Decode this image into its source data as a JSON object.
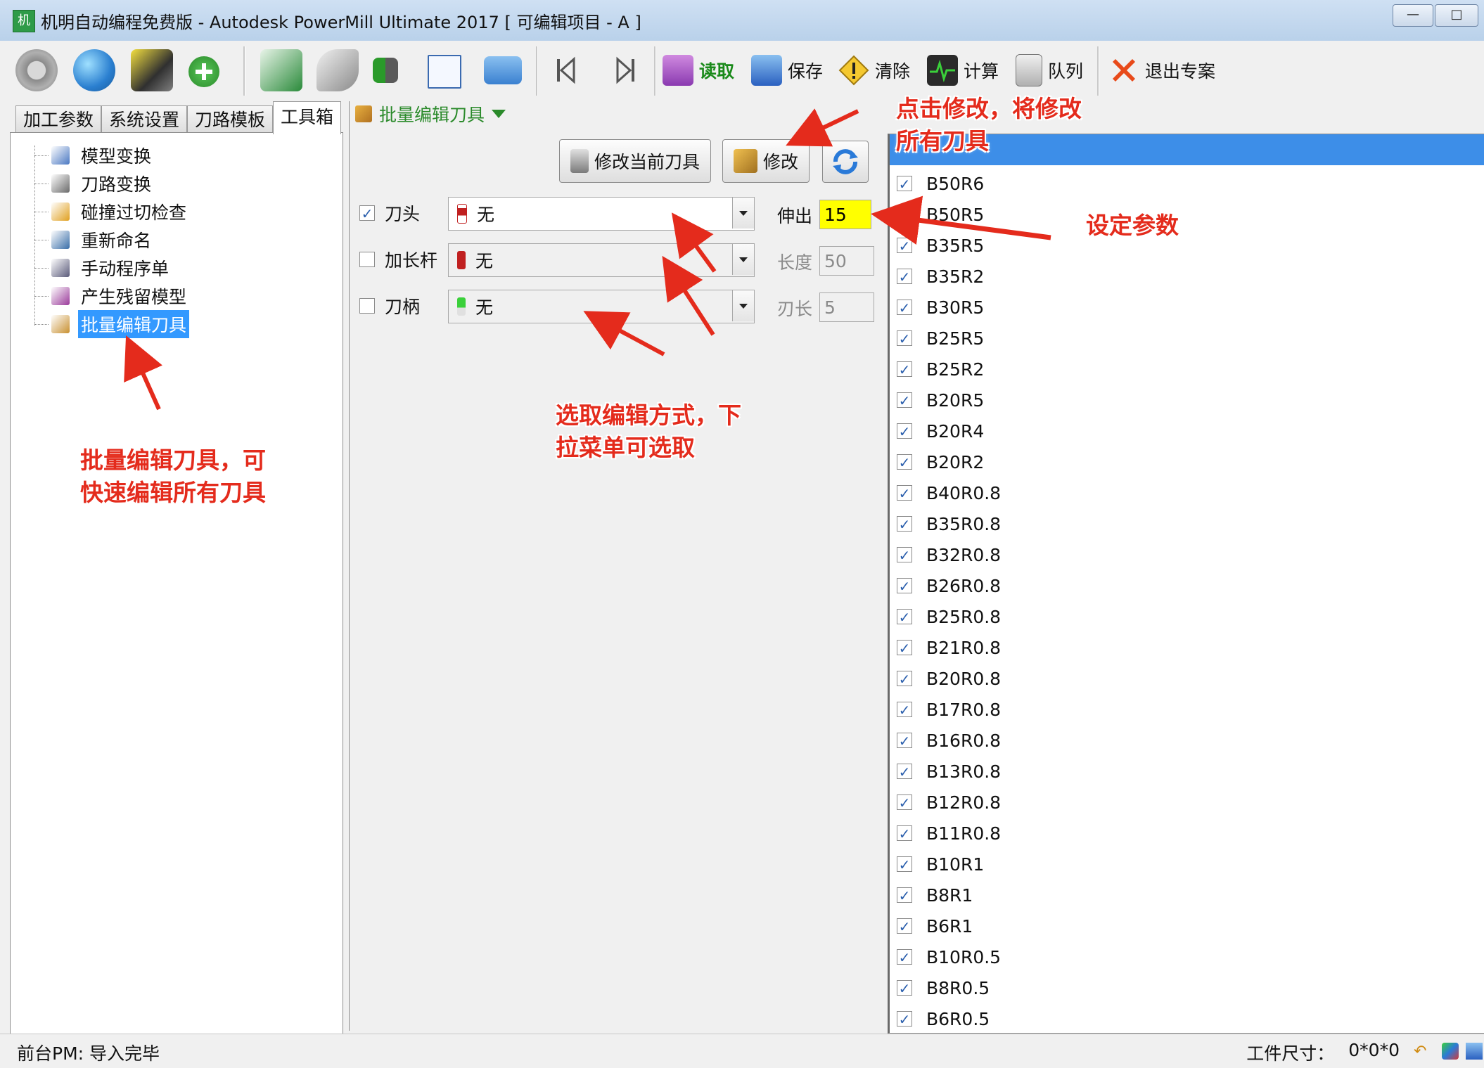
{
  "window": {
    "title": "机明自动编程免费版 - Autodesk PowerMill Ultimate 2017  [ 可编辑项目 - A ]",
    "app_icon_text": "机",
    "minimize": "—",
    "maximize": "□"
  },
  "toolbar": {
    "read_label": "读取",
    "save_label": "保存",
    "clear_label": "清除",
    "compute_label": "计算",
    "queue_label": "队列",
    "exit_label": "退出专案"
  },
  "left_tabs": [
    "加工参数",
    "系统设置",
    "刀路模板",
    "工具箱"
  ],
  "tree": {
    "items": [
      {
        "label": "模型变换",
        "icon": "model-transform-icon",
        "color": "#4a78c2"
      },
      {
        "label": "刀路变换",
        "icon": "toolpath-transform-icon",
        "color": "#6a6a6a"
      },
      {
        "label": "碰撞过切检查",
        "icon": "collision-check-icon",
        "color": "#e0a020"
      },
      {
        "label": "重新命名",
        "icon": "rename-icon",
        "color": "#3a6ea8"
      },
      {
        "label": "手动程序单",
        "icon": "manual-sheet-icon",
        "color": "#5a5a7a"
      },
      {
        "label": "产生残留模型",
        "icon": "stock-model-icon",
        "color": "#9a3a9a"
      },
      {
        "label": "批量编辑刀具",
        "icon": "batch-edit-tools-icon",
        "color": "#c89030"
      }
    ]
  },
  "mid": {
    "header": "批量编辑刀具",
    "modify_current_btn": "修改当前刀具",
    "modify_btn": "修改",
    "rows": [
      {
        "label": "刀头",
        "checked": true,
        "value": "无",
        "param_label": "伸出",
        "param_value": "15",
        "enabled": true
      },
      {
        "label": "加长杆",
        "checked": false,
        "value": "无",
        "param_label": "长度",
        "param_value": "50",
        "enabled": false
      },
      {
        "label": "刀柄",
        "checked": false,
        "value": "无",
        "param_label": "刃长",
        "param_value": "5",
        "enabled": false
      }
    ]
  },
  "tool_list": [
    "B50R6",
    "B50R5",
    "B35R5",
    "B35R2",
    "B30R5",
    "B25R5",
    "B25R2",
    "B20R5",
    "B20R4",
    "B20R2",
    "B40R0.8",
    "B35R0.8",
    "B32R0.8",
    "B26R0.8",
    "B25R0.8",
    "B21R0.8",
    "B20R0.8",
    "B17R0.8",
    "B16R0.8",
    "B13R0.8",
    "B12R0.8",
    "B11R0.8",
    "B10R1",
    "B8R1",
    "B6R1",
    "B10R0.5",
    "B8R0.5",
    "B6R0.5"
  ],
  "status": {
    "left": "前台PM: 导入完毕",
    "size_label": "工件尺寸：",
    "size_value": "0*0*0"
  },
  "annotations": {
    "modify_note_line1": "点击修改，将修改",
    "modify_note_line2": "所有刀具",
    "param_note": "设定参数",
    "select_note_line1": "选取编辑方式，下",
    "select_note_line2": "拉菜单可选取",
    "batch_note_line1": "批量编辑刀具，可",
    "batch_note_line2": "快速编辑所有刀具"
  },
  "colors": {
    "accent_blue": "#3399ff",
    "annotation_red": "#e42b1c",
    "highlight_yellow": "#ffff00"
  }
}
